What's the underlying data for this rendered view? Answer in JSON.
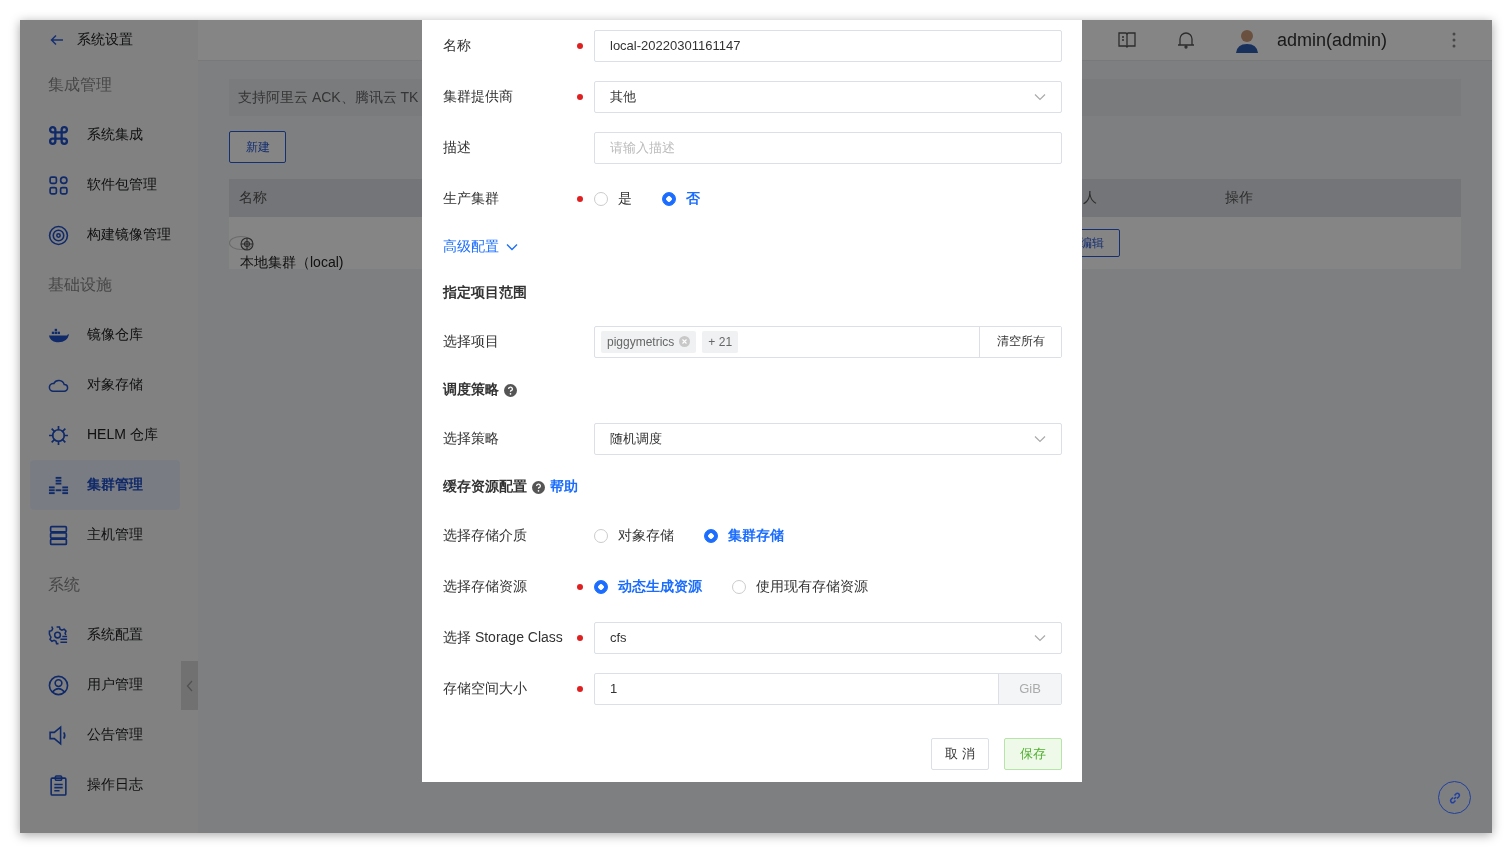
{
  "sidebar": {
    "back_title": "系统设置",
    "groups": [
      {
        "label": "集成管理",
        "items": [
          {
            "label": "系统集成",
            "selected": false
          },
          {
            "label": "软件包管理",
            "selected": false
          },
          {
            "label": "构建镜像管理",
            "selected": false
          }
        ]
      },
      {
        "label": "基础设施",
        "items": [
          {
            "label": "镜像仓库",
            "selected": false
          },
          {
            "label": "对象存储",
            "selected": false
          },
          {
            "label": "HELM 仓库",
            "selected": false
          },
          {
            "label": "集群管理",
            "selected": true
          },
          {
            "label": "主机管理",
            "selected": false
          }
        ]
      },
      {
        "label": "系统",
        "items": [
          {
            "label": "系统配置",
            "selected": false
          },
          {
            "label": "用户管理",
            "selected": false
          },
          {
            "label": "公告管理",
            "selected": false
          },
          {
            "label": "操作日志",
            "selected": false
          }
        ]
      }
    ]
  },
  "topbar": {
    "user": "admin(admin)"
  },
  "page": {
    "banner": "支持阿里云 ACK、腾讯云 TK",
    "new_button": "新建",
    "columns": [
      "名称",
      "人",
      "操作"
    ],
    "rows": [
      {
        "name": "本地集群（local)",
        "action": "编辑"
      }
    ]
  },
  "dialog": {
    "rows": [
      {
        "kind": "input",
        "label": "名称",
        "required": true,
        "value": "local-20220301161147"
      },
      {
        "kind": "select",
        "label": "集群提供商",
        "required": true,
        "value": "其他"
      },
      {
        "kind": "input",
        "label": "描述",
        "required": false,
        "placeholder": "请输入描述"
      },
      {
        "kind": "radio",
        "label": "生产集群",
        "required": true,
        "options": [
          {
            "label": "是",
            "selected": false
          },
          {
            "label": "否",
            "selected": true
          }
        ]
      },
      {
        "kind": "link",
        "label": "高级配置",
        "expanded": true
      },
      {
        "kind": "section",
        "label": "指定项目范围"
      },
      {
        "kind": "tags",
        "label": "选择项目",
        "required": false,
        "tags": [
          "piggymetrics"
        ],
        "more": "+ 21",
        "button": "清空所有"
      },
      {
        "kind": "section",
        "label": "调度策略",
        "help": true
      },
      {
        "kind": "select",
        "label": "选择策略",
        "required": false,
        "value": "随机调度"
      },
      {
        "kind": "section",
        "label": "缓存资源配置",
        "help": true,
        "link": "帮助"
      },
      {
        "kind": "radio",
        "label": "选择存储介质",
        "required": false,
        "options": [
          {
            "label": "对象存储",
            "selected": false
          },
          {
            "label": "集群存储",
            "selected": true
          }
        ]
      },
      {
        "kind": "radio",
        "label": "选择存储资源",
        "required": true,
        "options": [
          {
            "label": "动态生成资源",
            "selected": true
          },
          {
            "label": "使用现有存储资源",
            "selected": false
          }
        ]
      },
      {
        "kind": "select",
        "label": "选择 Storage Class",
        "required": true,
        "value": "cfs"
      },
      {
        "kind": "addon",
        "label": "存储空间大小",
        "required": true,
        "value": "1",
        "addon": "GiB"
      }
    ],
    "cancel": "取 消",
    "save": "保存"
  }
}
